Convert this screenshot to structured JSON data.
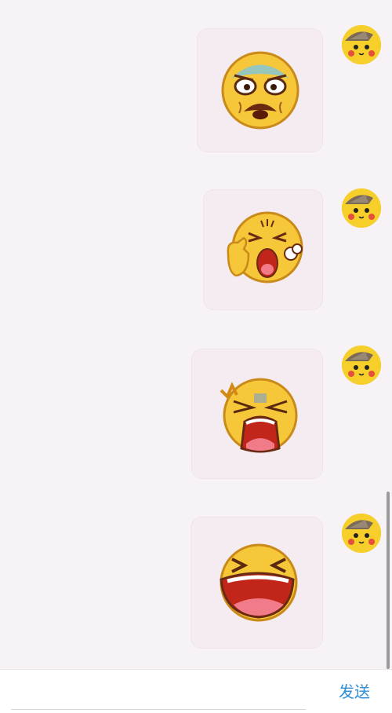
{
  "bottom_bar": {
    "send_label": "发送"
  },
  "messages": [
    {
      "sticker": "worried-old-face-emoji",
      "avatar": "pikachu-detective-avatar"
    },
    {
      "sticker": "thumbs-up-huffing-emoji",
      "avatar": "pikachu-detective-avatar"
    },
    {
      "sticker": "screaming-angry-emoji",
      "avatar": "pikachu-detective-avatar"
    },
    {
      "sticker": "laughing-crying-emoji",
      "avatar": "pikachu-detective-avatar"
    }
  ],
  "colors": {
    "background": "#f6f2f6",
    "bubble": "#f5ecf1",
    "send": "#2f8fd6",
    "emoji_yellow": "#f7c73a",
    "mouth_red": "#d23a25"
  }
}
